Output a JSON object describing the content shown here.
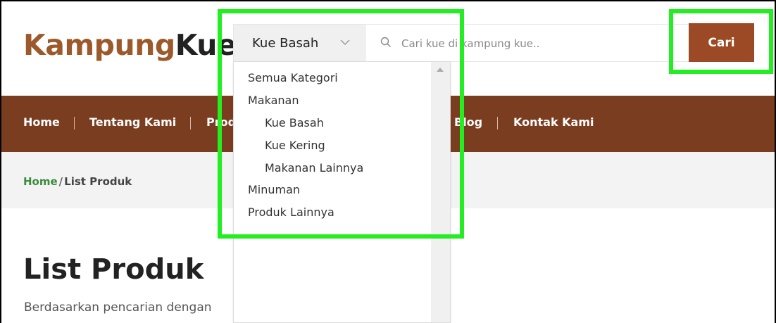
{
  "logo": {
    "part1": "Kampung",
    "part2": "Kue"
  },
  "search": {
    "category_selected": "Kue Basah",
    "placeholder": "Cari kue di kampung kue..",
    "button_label": "Cari"
  },
  "nav": {
    "items": [
      "Home",
      "Tentang Kami",
      "Prod",
      "Blog",
      "Kontak Kami"
    ]
  },
  "breadcrumb": {
    "home": "Home",
    "separator": "/",
    "current": "List Produk"
  },
  "page": {
    "title": "List Produk",
    "subtitle": "Berdasarkan pencarian dengan"
  },
  "dropdown": {
    "options": [
      "Semua Kategori",
      "Makanan",
      "Kue Basah",
      "Kue Kering",
      "Makanan Lainnya",
      "Minuman",
      "Produk Lainnya"
    ]
  },
  "colors": {
    "brand_brown": "#9c5a2c",
    "nav_brown": "#7b3d20",
    "button_brown": "#9c4a25",
    "breadcrumb_green": "#3d8b3d",
    "highlight_green": "#22ee22"
  }
}
